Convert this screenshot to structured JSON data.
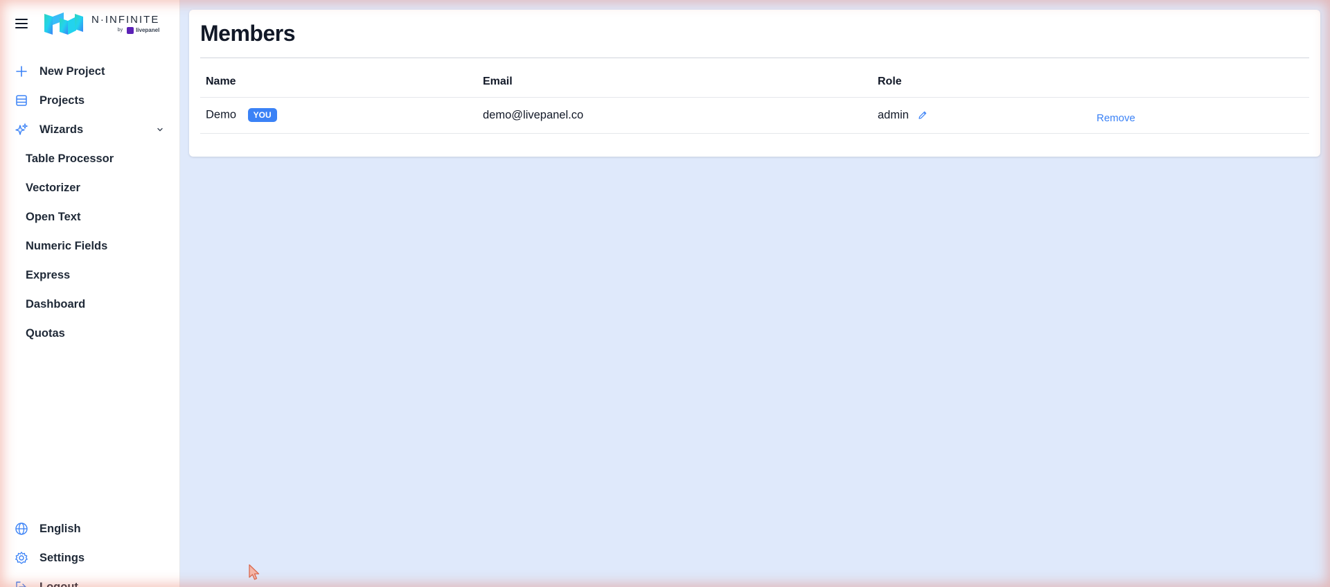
{
  "brand": {
    "name": "N·INFINITE",
    "by": "by",
    "partner": "livepanel"
  },
  "sidebar": {
    "items": [
      {
        "label": "New Project",
        "icon": "plus-icon"
      },
      {
        "label": "Projects",
        "icon": "table-icon"
      },
      {
        "label": "Wizards",
        "icon": "sparkles-icon"
      }
    ],
    "wizards": [
      {
        "label": "Table Processor"
      },
      {
        "label": "Vectorizer"
      },
      {
        "label": "Open Text"
      },
      {
        "label": "Numeric Fields"
      },
      {
        "label": "Express"
      },
      {
        "label": "Dashboard"
      },
      {
        "label": "Quotas"
      }
    ],
    "bottom": [
      {
        "label": "English",
        "icon": "globe-icon"
      },
      {
        "label": "Settings",
        "icon": "gear-icon"
      },
      {
        "label": "Logout",
        "icon": "logout-icon"
      }
    ]
  },
  "main": {
    "title": "Members",
    "columns": [
      "Name",
      "Email",
      "Role"
    ],
    "rows": [
      {
        "name": "Demo",
        "badge": "YOU",
        "email": "demo@livepanel.co",
        "role": "admin",
        "action": "Remove"
      }
    ]
  },
  "colors": {
    "accent": "#3b82f6",
    "background": "#dfe9fb",
    "text": "#111827"
  }
}
